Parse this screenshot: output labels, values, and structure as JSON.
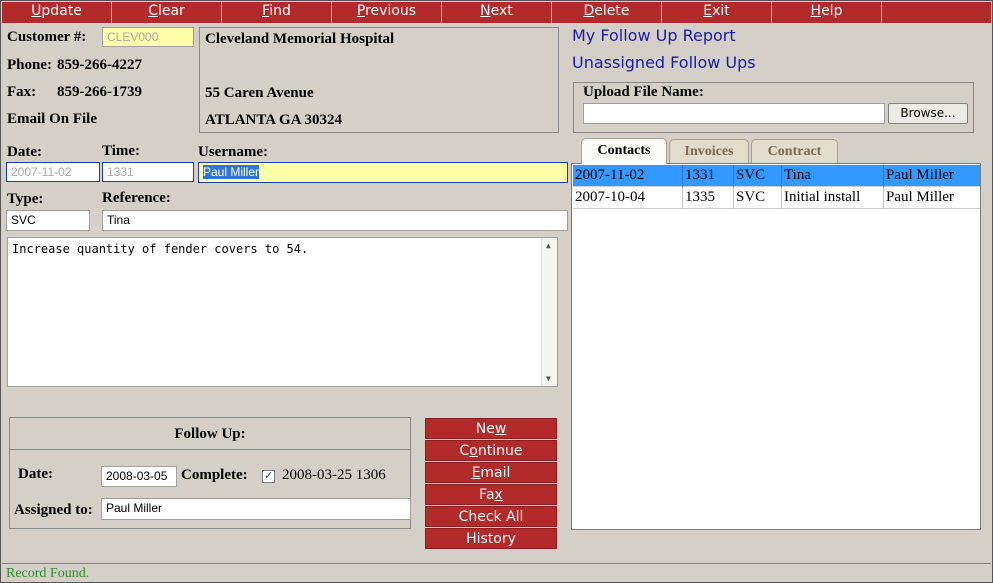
{
  "menu": [
    {
      "pre": "",
      "key": "U",
      "post": "pdate"
    },
    {
      "pre": "",
      "key": "C",
      "post": "lear"
    },
    {
      "pre": "",
      "key": "F",
      "post": "ind"
    },
    {
      "pre": "",
      "key": "P",
      "post": "revious"
    },
    {
      "pre": "",
      "key": "N",
      "post": "ext"
    },
    {
      "pre": "",
      "key": "D",
      "post": "elete"
    },
    {
      "pre": "",
      "key": "E",
      "post": "xit"
    },
    {
      "pre": "",
      "key": "H",
      "post": "elp"
    }
  ],
  "customer": {
    "number_label": "Customer #:",
    "number_value": "CLEV000",
    "phone_label": "Phone:",
    "phone_value": "859-266-4227",
    "fax_label": "Fax:",
    "fax_value": "859-266-1739",
    "email_text": "Email On File",
    "name": "Cleveland Memorial Hospital",
    "address1": "55 Caren Avenue",
    "address2": "ATLANTA GA 30324"
  },
  "links": {
    "my_report": "My Follow Up Report",
    "unassigned": "Unassigned Follow Ups"
  },
  "upload": {
    "label": "Upload File Name:",
    "value": "",
    "browse": "Browse..."
  },
  "record": {
    "date_label": "Date:",
    "date_value": "2007-11-02",
    "time_label": "Time:",
    "time_value": "1331",
    "username_label": "Username:",
    "username_value": "Paul Miller",
    "type_label": "Type:",
    "type_value": "SVC",
    "reference_label": "Reference:",
    "reference_value": "Tina",
    "notes": "Increase quantity of fender covers to 54."
  },
  "followup": {
    "title": "Follow Up:",
    "date_label": "Date:",
    "date_value": "2008-03-05",
    "complete_label": "Complete:",
    "complete_checked": "✓",
    "complete_value": "2008-03-25 1306",
    "assigned_label": "Assigned to:",
    "assigned_value": "Paul Miller"
  },
  "actions": {
    "new": {
      "pre": "Ne",
      "key": "w",
      "post": ""
    },
    "continue": {
      "pre": "C",
      "key": "o",
      "post": "ntinue"
    },
    "email": {
      "pre": "",
      "key": "E",
      "post": "mail"
    },
    "fax": {
      "pre": "Fa",
      "key": "x",
      "post": ""
    },
    "check_all": {
      "pre": "Check All",
      "key": "",
      "post": ""
    },
    "history": {
      "pre": "History",
      "key": "",
      "post": ""
    }
  },
  "tabs": {
    "contacts": "Contacts",
    "invoices": "Invoices",
    "contract": "Contract"
  },
  "contacts": [
    {
      "date": "2007-11-02",
      "time": "1331",
      "type": "SVC",
      "reference": "Tina",
      "user": "Paul Miller"
    },
    {
      "date": "2007-10-04",
      "time": "1335",
      "type": "SVC",
      "reference": "Initial install",
      "user": "Paul Miller"
    }
  ],
  "status": "Record Found.",
  "colors": {
    "menu_bar": "#b22a2a",
    "background": "#d4d0c8",
    "highlight_input": "#ffffa8",
    "selected_row": "#3399ff",
    "link": "#1a1aa8",
    "status_text": "#2a8a2a"
  }
}
